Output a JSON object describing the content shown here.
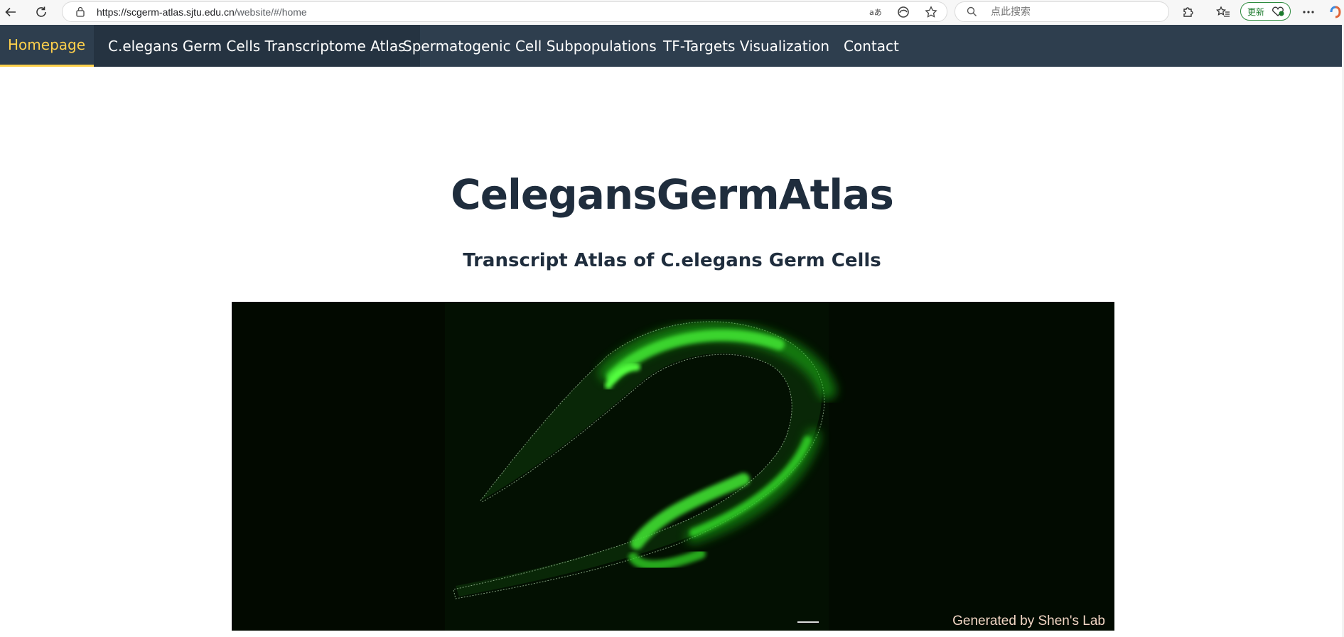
{
  "browser": {
    "url_host": "https://scgerm-atlas.sjtu.edu.cn",
    "url_path": "/website/#/home",
    "search_placeholder": "点此搜索",
    "update_label": "更新"
  },
  "nav": {
    "items": [
      {
        "label": "Homepage",
        "active": true
      },
      {
        "label": "C.elegans Germ Cells Transcriptome Atlas",
        "active": false
      },
      {
        "label": "Spermatogenic Cell Subpopulations",
        "active": false
      },
      {
        "label": "TF-Targets Visualization",
        "active": false
      },
      {
        "label": "Contact",
        "active": false
      }
    ]
  },
  "main": {
    "title": "CelegansGermAtlas",
    "subtitle": "Transcript Atlas of C.elegans Germ Cells",
    "banner_credit": "Generated by Shen's Lab"
  },
  "colors": {
    "nav_bg": "#2e3e4e",
    "nav_active": "#ffd04b",
    "title_text": "#1f2d3d",
    "banner_bg": "#010a00",
    "fluorescence": "#22c51a"
  }
}
